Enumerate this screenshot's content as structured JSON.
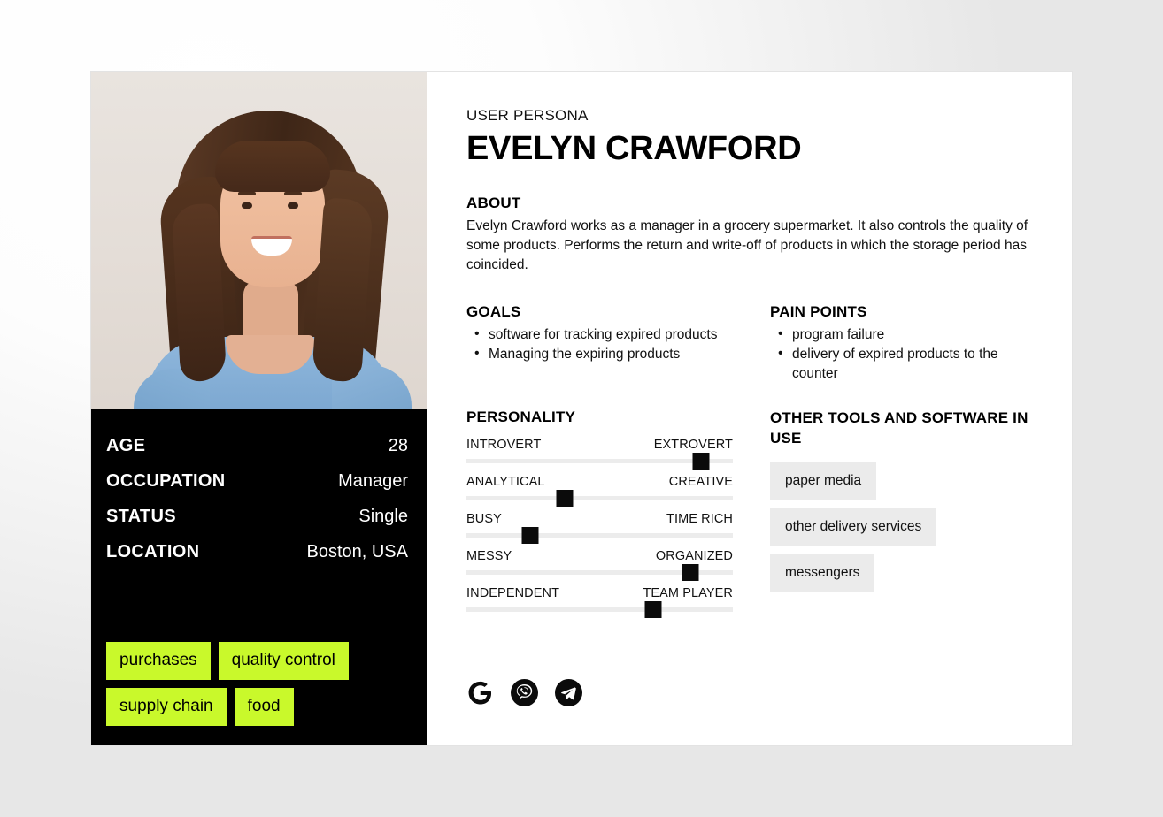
{
  "card": {
    "eyebrow": "USER PERSONA",
    "name": "EVELYN CRAWFORD"
  },
  "photo": {
    "alt": "portrait-photo-of-evelyn-crawford",
    "background_color": "#e6e0da"
  },
  "info": {
    "rows": [
      {
        "label": "AGE",
        "value": "28"
      },
      {
        "label": "OCCUPATION",
        "value": "Manager"
      },
      {
        "label": "STATUS",
        "value": "Single"
      },
      {
        "label": "LOCATION",
        "value": "Boston, USA"
      }
    ]
  },
  "tags": {
    "color": "#c9f92b",
    "items": [
      "purchases",
      "quality control",
      "supply chain",
      "food"
    ]
  },
  "about": {
    "heading": "ABOUT",
    "body": "Evelyn Crawford works as a manager in a grocery supermarket. It also controls the quality of some products. Performs the return and write-off of products in which the storage period has coincided."
  },
  "goals": {
    "heading": "GOALS",
    "items": [
      "software for tracking expired products",
      "Managing the expiring products"
    ]
  },
  "pain_points": {
    "heading": "PAIN POINTS",
    "items": [
      "program failure",
      "delivery of expired products to the counter"
    ]
  },
  "personality": {
    "heading": "PERSONALITY",
    "sliders": [
      {
        "left": "INTROVERT",
        "right": "EXTROVERT",
        "value": 88
      },
      {
        "left": "ANALYTICAL",
        "right": "CREATIVE",
        "value": 37
      },
      {
        "left": "BUSY",
        "right": "TIME RICH",
        "value": 24
      },
      {
        "left": "MESSY",
        "right": "ORGANIZED",
        "value": 84
      },
      {
        "left": "INDEPENDENT",
        "right": "TEAM PLAYER",
        "value": 70
      }
    ]
  },
  "tools": {
    "heading": "OTHER TOOLS AND SOFTWARE IN USE",
    "items": [
      "paper media",
      "other delivery services",
      "messengers"
    ],
    "social_icons": [
      "google-icon",
      "viber-icon",
      "telegram-icon"
    ]
  }
}
